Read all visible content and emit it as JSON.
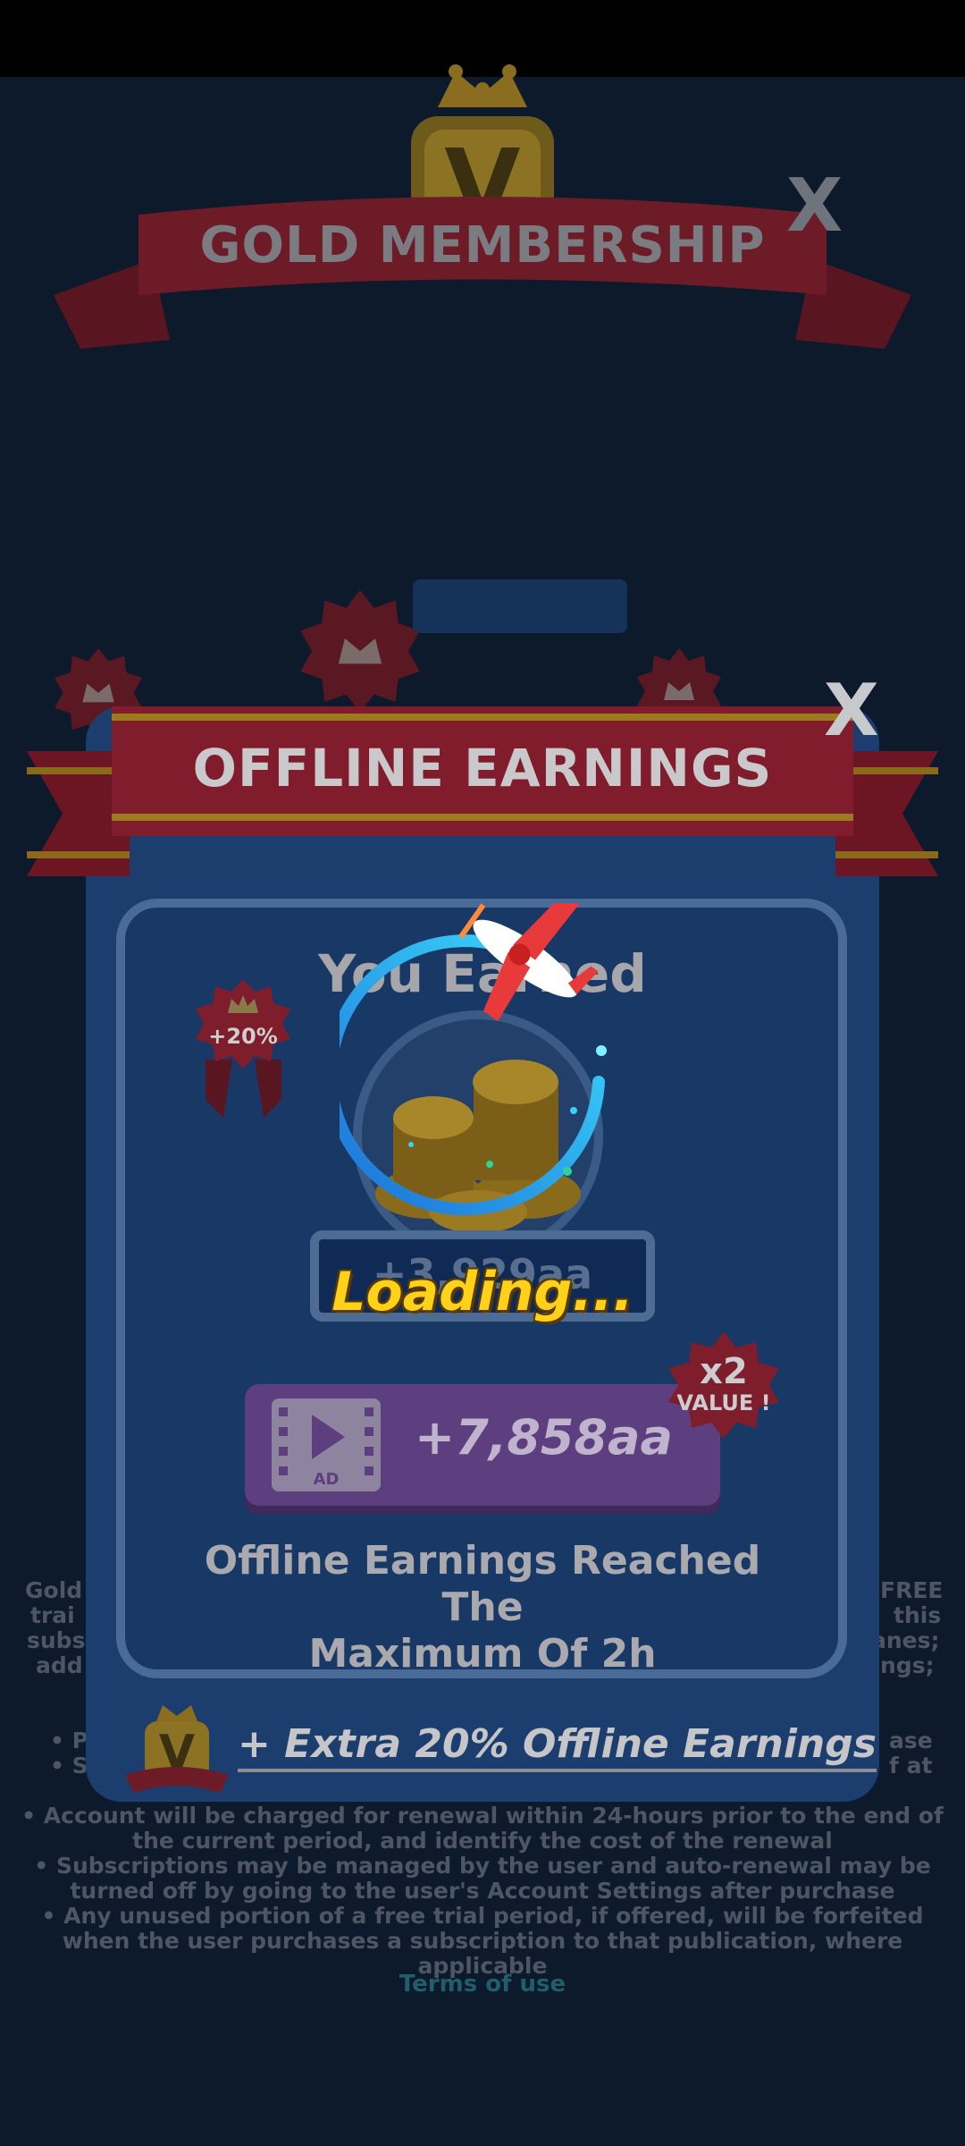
{
  "background": {
    "title": "GOLD MEMBERSHIP",
    "close_label": "X",
    "terms": {
      "left_fragments": [
        "Gold",
        "trai",
        "subs",
        "add"
      ],
      "right_fragments": [
        "FREE",
        "this",
        "anes;",
        "ngs;"
      ],
      "bullet_left": [
        "• P",
        "• Su"
      ],
      "bullet_right": [
        "ase",
        "f at"
      ],
      "lines": [
        "• Account will be charged for renewal within 24-hours prior to the end of",
        "the current period, and identify the cost of the renewal",
        "• Subscriptions may be managed by the user and auto-renewal may be",
        "turned off by going to the user's Account Settings after purchase",
        "• Any unused portion of a free trial period, if offered, will be forfeited",
        "when the user purchases a subscription to that publication, where",
        "applicable"
      ],
      "link": "Terms of use"
    }
  },
  "dialog": {
    "title": "OFFLINE EARNINGS",
    "close_label": "X",
    "you_earned": "You Earned",
    "amount": "+3,929aa",
    "bonus_badge": "+20%",
    "ad_button": {
      "icon": "video-ad-icon",
      "icon_label": "AD",
      "label": "+7,858aa"
    },
    "x2_badge": {
      "top": "x2",
      "bottom": "VALUE !"
    },
    "reached_line1": "Offline Earnings Reached The",
    "reached_line2": "Maximum Of 2h",
    "extra_label": "+ Extra 20%  Offline Earnings"
  },
  "loading": {
    "text": "Loading..."
  },
  "colors": {
    "ribbon_red": "#8f1f30",
    "gold": "#c79a2a",
    "loading_yellow": "#ffd21a",
    "spinner_cyan": "#2fc6ff"
  }
}
